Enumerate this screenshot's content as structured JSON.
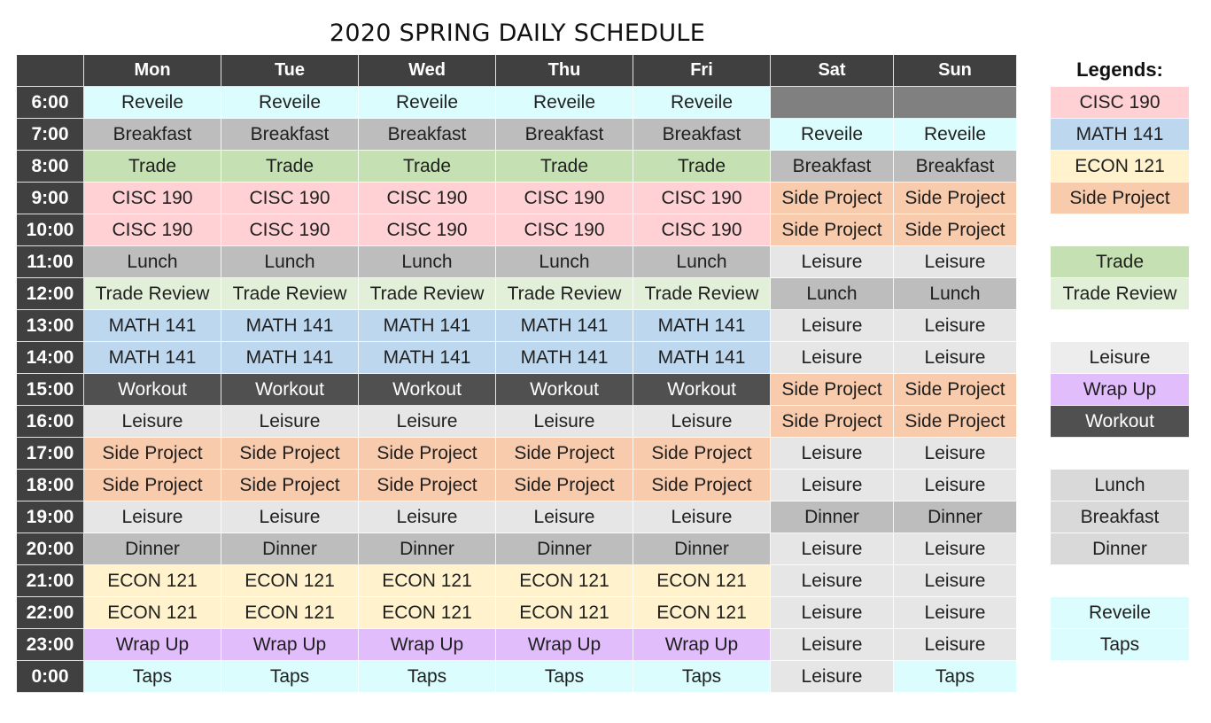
{
  "title": "2020 SPRING DAILY SCHEDULE",
  "days": [
    "Mon",
    "Tue",
    "Wed",
    "Thu",
    "Fri",
    "Sat",
    "Sun"
  ],
  "rows": [
    {
      "time": "6:00",
      "cells": [
        "Reveile",
        "Reveile",
        "Reveile",
        "Reveile",
        "Reveile",
        "",
        ""
      ]
    },
    {
      "time": "7:00",
      "cells": [
        "Breakfast",
        "Breakfast",
        "Breakfast",
        "Breakfast",
        "Breakfast",
        "Reveile",
        "Reveile"
      ]
    },
    {
      "time": "8:00",
      "cells": [
        "Trade",
        "Trade",
        "Trade",
        "Trade",
        "Trade",
        "Breakfast",
        "Breakfast"
      ]
    },
    {
      "time": "9:00",
      "cells": [
        "CISC 190",
        "CISC 190",
        "CISC 190",
        "CISC 190",
        "CISC 190",
        "Side Project",
        "Side Project"
      ]
    },
    {
      "time": "10:00",
      "cells": [
        "CISC 190",
        "CISC 190",
        "CISC 190",
        "CISC 190",
        "CISC 190",
        "Side Project",
        "Side Project"
      ]
    },
    {
      "time": "11:00",
      "cells": [
        "Lunch",
        "Lunch",
        "Lunch",
        "Lunch",
        "Lunch",
        "Leisure",
        "Leisure"
      ]
    },
    {
      "time": "12:00",
      "cells": [
        "Trade Review",
        "Trade Review",
        "Trade Review",
        "Trade Review",
        "Trade Review",
        "Lunch",
        "Lunch"
      ]
    },
    {
      "time": "13:00",
      "cells": [
        "MATH 141",
        "MATH 141",
        "MATH 141",
        "MATH 141",
        "MATH 141",
        "Leisure",
        "Leisure"
      ]
    },
    {
      "time": "14:00",
      "cells": [
        "MATH 141",
        "MATH 141",
        "MATH 141",
        "MATH 141",
        "MATH 141",
        "Leisure",
        "Leisure"
      ]
    },
    {
      "time": "15:00",
      "cells": [
        "Workout",
        "Workout",
        "Workout",
        "Workout",
        "Workout",
        "Side Project",
        "Side Project"
      ]
    },
    {
      "time": "16:00",
      "cells": [
        "Leisure",
        "Leisure",
        "Leisure",
        "Leisure",
        "Leisure",
        "Side Project",
        "Side Project"
      ]
    },
    {
      "time": "17:00",
      "cells": [
        "Side Project",
        "Side Project",
        "Side Project",
        "Side Project",
        "Side Project",
        "Leisure",
        "Leisure"
      ]
    },
    {
      "time": "18:00",
      "cells": [
        "Side Project",
        "Side Project",
        "Side Project",
        "Side Project",
        "Side Project",
        "Leisure",
        "Leisure"
      ]
    },
    {
      "time": "19:00",
      "cells": [
        "Leisure",
        "Leisure",
        "Leisure",
        "Leisure",
        "Leisure",
        "Dinner",
        "Dinner"
      ]
    },
    {
      "time": "20:00",
      "cells": [
        "Dinner",
        "Dinner",
        "Dinner",
        "Dinner",
        "Dinner",
        "Leisure",
        "Leisure"
      ]
    },
    {
      "time": "21:00",
      "cells": [
        "ECON 121",
        "ECON 121",
        "ECON 121",
        "ECON 121",
        "ECON 121",
        "Leisure",
        "Leisure"
      ]
    },
    {
      "time": "22:00",
      "cells": [
        "ECON 121",
        "ECON 121",
        "ECON 121",
        "ECON 121",
        "ECON 121",
        "Leisure",
        "Leisure"
      ]
    },
    {
      "time": "23:00",
      "cells": [
        "Wrap Up",
        "Wrap Up",
        "Wrap Up",
        "Wrap Up",
        "Wrap Up",
        "Leisure",
        "Leisure"
      ]
    },
    {
      "time": "0:00",
      "cells": [
        "Taps",
        "Taps",
        "Taps",
        "Taps",
        "Taps",
        "Leisure",
        "Taps"
      ]
    }
  ],
  "legend_title": "Legends:",
  "legend_items": [
    "CISC 190",
    "MATH 141",
    "ECON 121",
    "Side Project",
    "",
    "Trade",
    "Trade Review",
    "",
    "Leisure",
    "Wrap Up",
    "Workout",
    "",
    "Lunch",
    "Breakfast",
    "Dinner",
    "",
    "Reveile",
    "Taps"
  ],
  "colors": {
    "header_bg": "#404040",
    "empty_bg": "#808080",
    "activities": {
      "Reveile": {
        "bg": "#dbfdfe",
        "fg": "#1f1f1f"
      },
      "Taps": {
        "bg": "#dbfdfe",
        "fg": "#1f1f1f"
      },
      "Breakfast": {
        "bg": "#bdbdbd",
        "fg": "#1f1f1f"
      },
      "Lunch": {
        "bg": "#bdbdbd",
        "fg": "#1f1f1f"
      },
      "Dinner": {
        "bg": "#bdbdbd",
        "fg": "#1f1f1f"
      },
      "Trade": {
        "bg": "#c5e0b3",
        "fg": "#1f1f1f"
      },
      "Trade Review": {
        "bg": "#e2efd9",
        "fg": "#1f1f1f"
      },
      "CISC 190": {
        "bg": "#ffd1d4",
        "fg": "#1f1f1f"
      },
      "MATH 141": {
        "bg": "#bdd7ee",
        "fg": "#1f1f1f"
      },
      "ECON 121": {
        "bg": "#fff2cc",
        "fg": "#1f1f1f"
      },
      "Side Project": {
        "bg": "#f8cbad",
        "fg": "#1f1f1f"
      },
      "Leisure": {
        "bg": "#e7e6e6",
        "fg": "#1f1f1f"
      },
      "Workout": {
        "bg": "#505050",
        "fg": "#ffffff"
      },
      "Wrap Up": {
        "bg": "#e2bdfb",
        "fg": "#1f1f1f"
      }
    },
    "legend_overrides": {
      "Lunch": "#d9d9d9",
      "Breakfast": "#d9d9d9",
      "Dinner": "#d9d9d9",
      "Leisure": "#ededed"
    }
  }
}
